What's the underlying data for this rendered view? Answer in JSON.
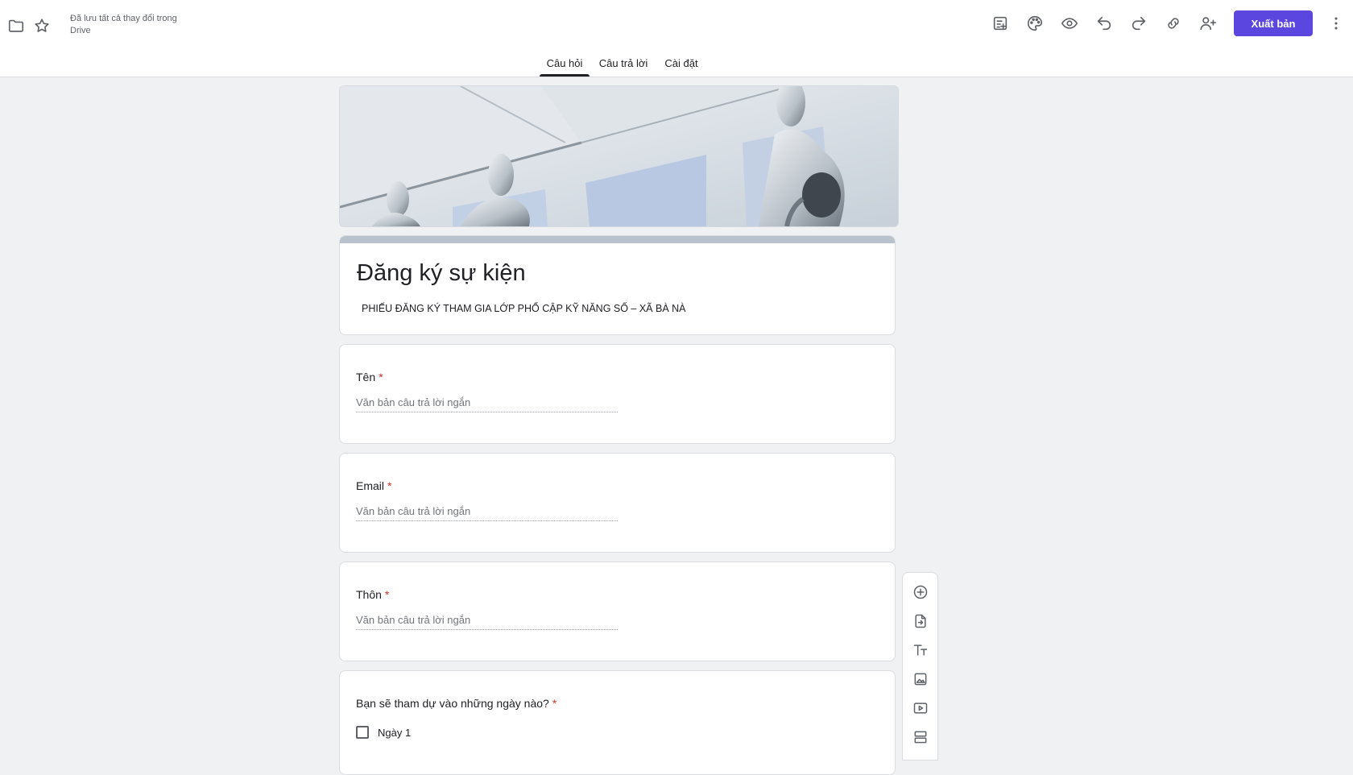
{
  "header": {
    "save_status": "Đã lưu tất cả thay đổi trong Drive",
    "publish_label": "Xuất bản",
    "icons": [
      "folder-icon",
      "star-icon",
      "add-ons-icon",
      "palette-icon",
      "preview-eye-icon",
      "undo-icon",
      "redo-icon",
      "link-icon",
      "add-collaborator-icon",
      "more-vert-icon"
    ]
  },
  "tabs": [
    {
      "label": "Câu hỏi",
      "active": true
    },
    {
      "label": "Câu trả lời",
      "active": false
    },
    {
      "label": "Cài đặt",
      "active": false
    }
  ],
  "form": {
    "title": "Đăng ký sự kiện",
    "description": "PHIẾU ĐĂNG KÝ THAM GIA LỚP PHỔ CẬP KỸ NĂNG SỐ – XÃ BÀ NÀ"
  },
  "questions": [
    {
      "label": "Tên",
      "required": "*",
      "placeholder": "Văn bản câu trả lời ngắn"
    },
    {
      "label": "Email",
      "required": "*",
      "placeholder": "Văn bản câu trả lời ngắn"
    },
    {
      "label": "Thôn",
      "required": "*",
      "placeholder": "Văn bản câu trả lời ngắn"
    },
    {
      "label": "Bạn sẽ tham dự vào những ngày nào?",
      "required": "*",
      "options": [
        "Ngày 1"
      ]
    }
  ],
  "side_toolbar": [
    "add-question-icon",
    "import-questions-icon",
    "add-title-text-icon",
    "add-image-icon",
    "add-video-icon",
    "add-section-icon"
  ],
  "colors": {
    "accent": "#5b47e0",
    "required": "#d93025",
    "background": "#f0f1f3"
  }
}
